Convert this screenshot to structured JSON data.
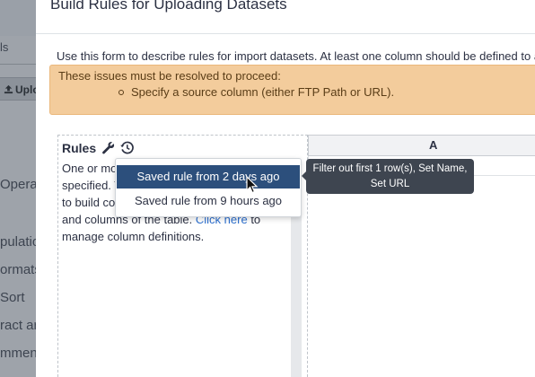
{
  "background": {
    "sidebar_labels": [
      "ls",
      "Operat",
      "pulatio",
      "ormats",
      "Sort",
      "ract ar",
      "mments"
    ],
    "upload_label": "Uplo",
    "upload_icon": "upload-icon"
  },
  "modal": {
    "title": "Build Rules for Uploading Datasets",
    "intro": "Use this form to describe rules for import datasets. At least one column should be defined to a s",
    "alert": {
      "heading": "These issues must be resolved to proceed:",
      "items": [
        "Specify a source column (either FTP Path or URL)."
      ]
    },
    "rules": {
      "title": "Rules",
      "icons": [
        "wrench-icon",
        "history-icon"
      ],
      "desc_1": "One or mo",
      "desc_2": "specified. T",
      "desc_3": "to build col",
      "desc_4": "and columns of the table.",
      "link": "Click here",
      "desc_5": "to",
      "desc_6": "manage column definitions."
    },
    "table": {
      "columns": [
        "A"
      ]
    },
    "dropdown": {
      "items": [
        "Saved rule from 2 days ago",
        "Saved rule from 9 hours ago"
      ]
    },
    "tooltip": {
      "line1": "Filter out first 1 row(s), Set Name,",
      "line2": "Set URL"
    }
  }
}
